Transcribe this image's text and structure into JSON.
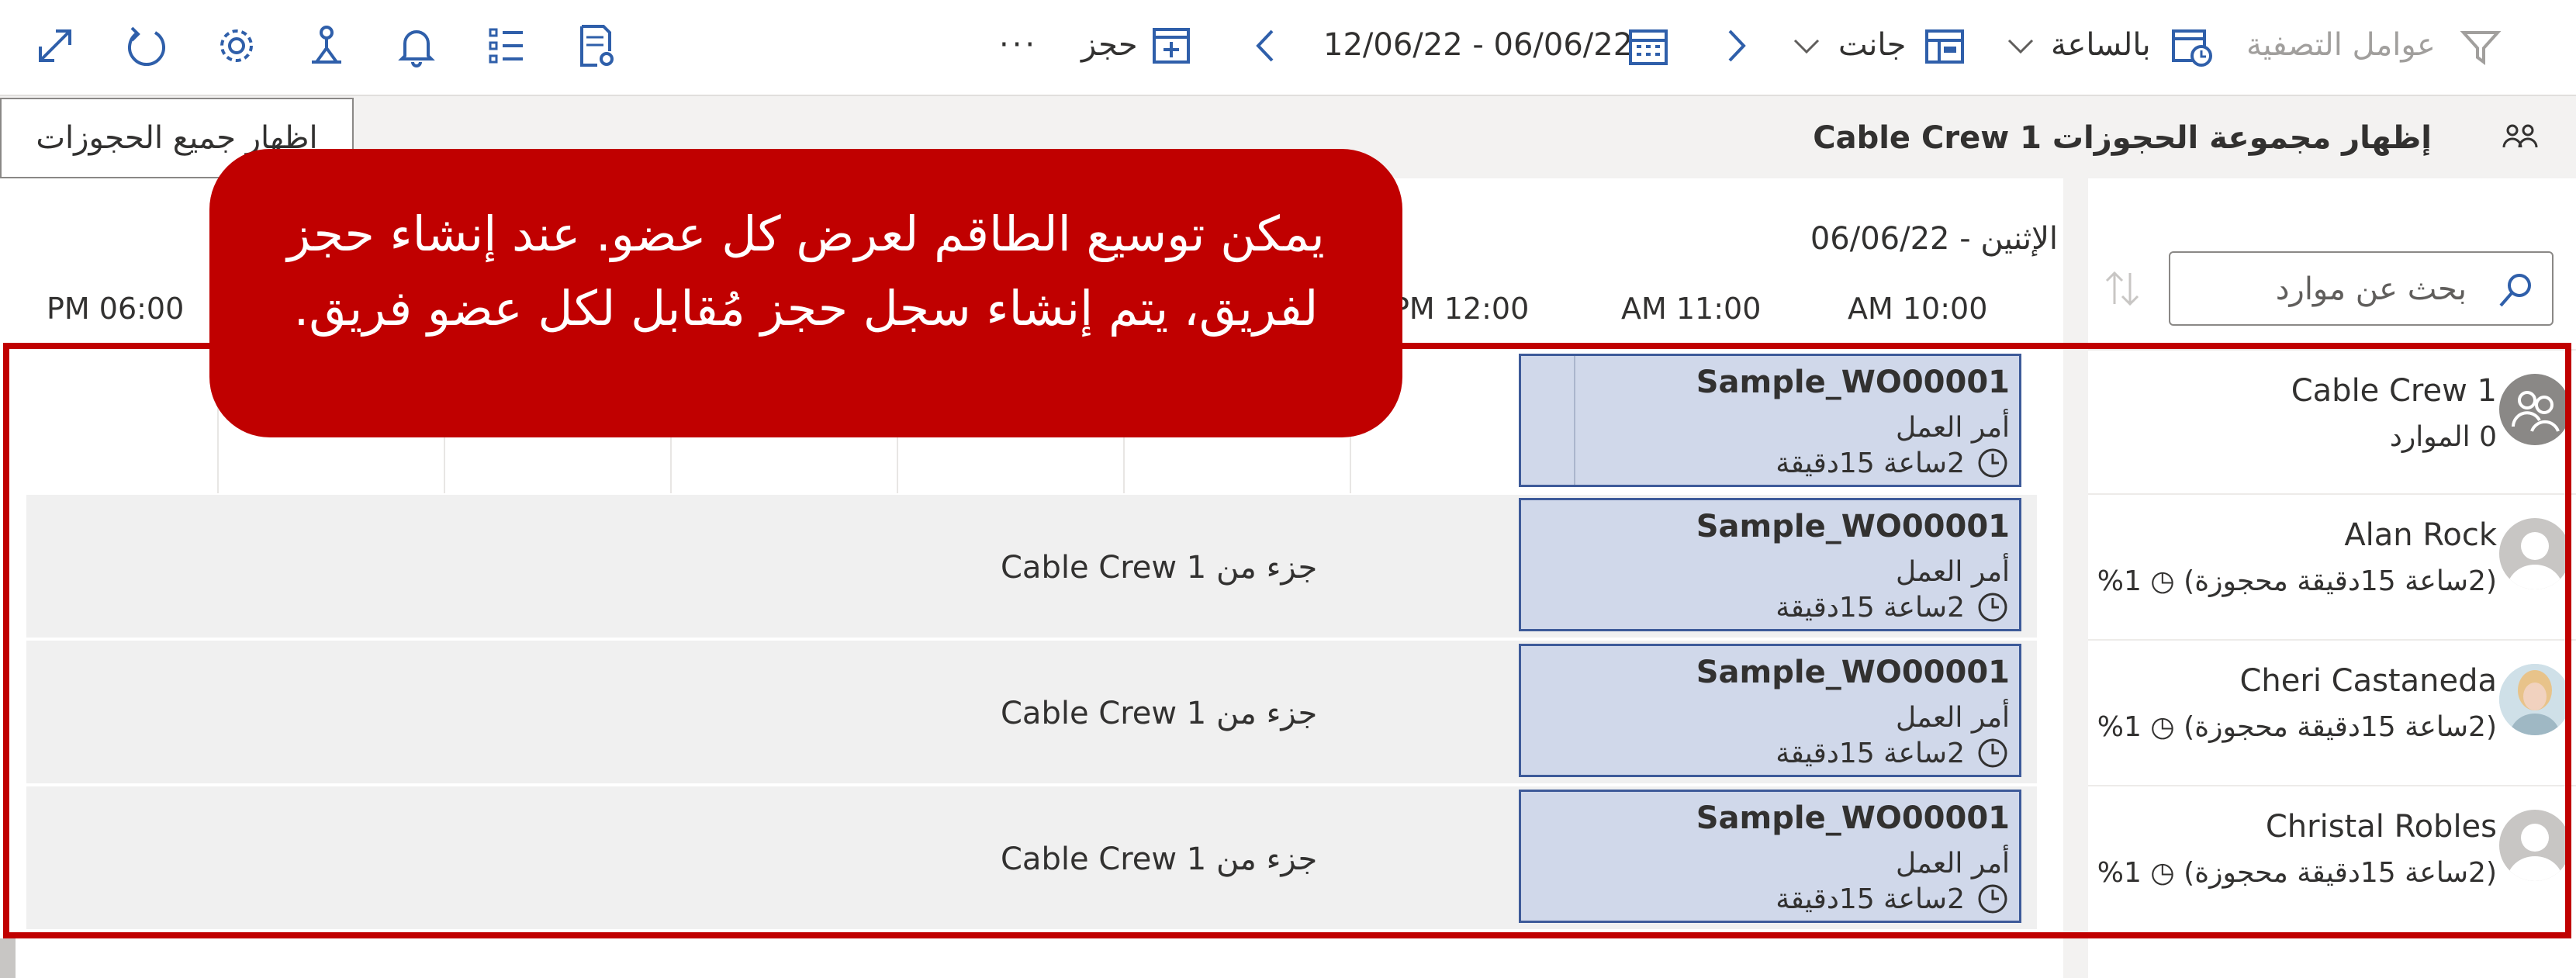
{
  "toolbar": {
    "filters_label": "عوامل التصفية",
    "view_mode_label": "بالساعة",
    "view_type_label": "جانت",
    "date_range": "12/06/22 - 06/06/22",
    "book_label": "حجز",
    "more_label": "···"
  },
  "subheader": {
    "group_title": "إظهار مجموعة الحجوزات Cable Crew 1",
    "show_all_label": "اظهار جميع الحجوزات"
  },
  "schedule": {
    "date_label": "الإثنين - 06/06/22",
    "hours": [
      "AM 10:00",
      "AM 11:00",
      "PM 12:00",
      "PM 06:00"
    ]
  },
  "search": {
    "placeholder": "بحث عن موارد"
  },
  "resources": [
    {
      "name": "Cable Crew 1",
      "sub": "0 الموارد",
      "avatar": "crew-icon"
    },
    {
      "name": "Alan Rock",
      "sub": "(2ساعة 15دقيقة محجوزة) ◷ 1%",
      "avatar": "person-icon"
    },
    {
      "name": "Cheri Castaneda",
      "sub": "(2ساعة 15دقيقة محجوزة) ◷ 1%",
      "avatar": "photo"
    },
    {
      "name": "Christal Robles",
      "sub": "(2ساعة 15دقيقة محجوزة) ◷ 1%",
      "avatar": "person-icon"
    }
  ],
  "rows": [
    {
      "part_of": ""
    },
    {
      "part_of": "جزء من Cable Crew 1"
    },
    {
      "part_of": "جزء من Cable Crew 1"
    },
    {
      "part_of": "جزء من Cable Crew 1"
    }
  ],
  "bookings": [
    {
      "title": "Sample_WO00001",
      "type": "أمر العمل",
      "duration": "2ساعة 15دقيقة"
    },
    {
      "title": "Sample_WO00001",
      "type": "أمر العمل",
      "duration": "2ساعة 15دقيقة"
    },
    {
      "title": "Sample_WO00001",
      "type": "أمر العمل",
      "duration": "2ساعة 15دقيقة"
    },
    {
      "title": "Sample_WO00001",
      "type": "أمر العمل",
      "duration": "2ساعة 15دقيقة"
    }
  ],
  "callout": {
    "line1": "يمكن توسيع الطاقم لعرض كل عضو. عند إنشاء حجز",
    "line2": "لفريق، يتم إنشاء سجل حجز مُقابل لكل عضو فريق."
  },
  "colors": {
    "accent": "#2f5faa",
    "booking_fill": "#d0d8ea",
    "booking_border": "#3d5a99",
    "callout": "#c00000"
  }
}
